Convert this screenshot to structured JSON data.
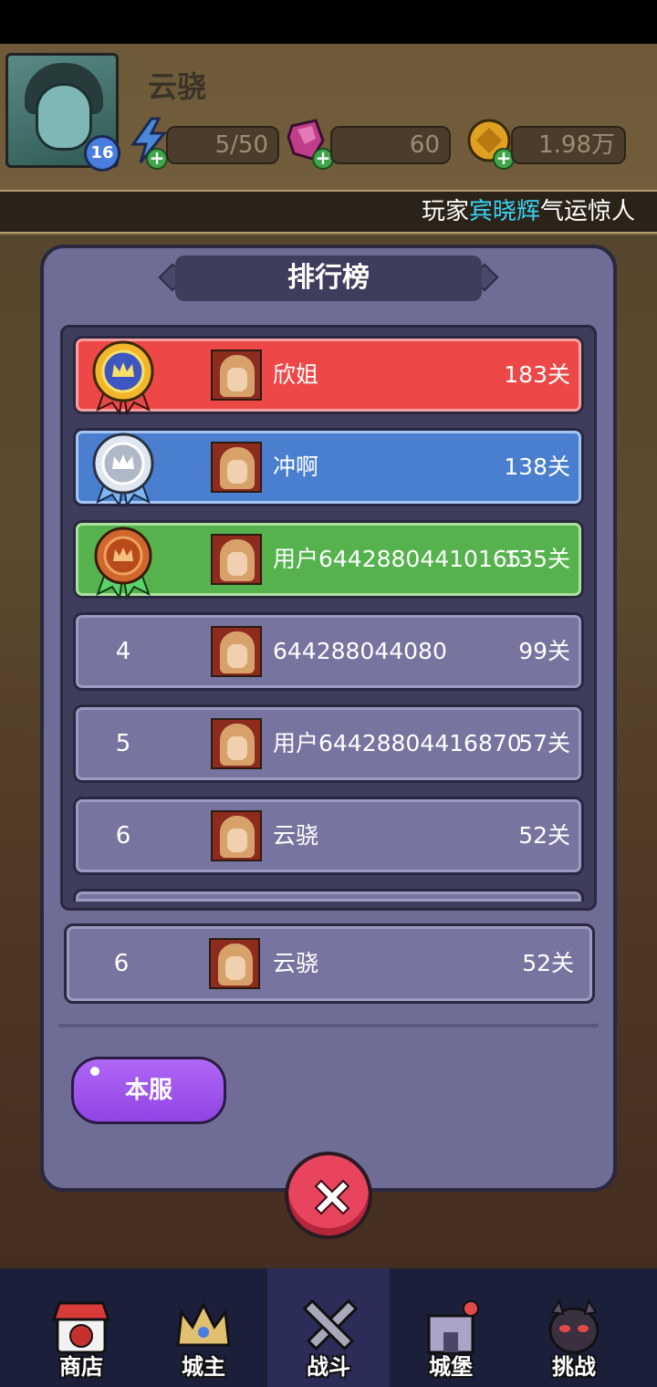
{
  "player": {
    "name": "云骁",
    "level": "16"
  },
  "resources": {
    "energy": "5/50",
    "gems": "60",
    "gold": "1.98万"
  },
  "marquee": {
    "prefix": "玩家",
    "highlight": "宾晓辉",
    "suffix": "气运惊人",
    "highlight_color": "#39d3f5"
  },
  "panel": {
    "title": "排行榜",
    "rows": [
      {
        "rank": "1",
        "medal": "gold-medal-icon",
        "name": "欣姐",
        "score": "183关",
        "color": "#ee4747"
      },
      {
        "rank": "2",
        "medal": "silver-medal-icon",
        "name": "冲啊",
        "score": "138关",
        "color": "#4a7fcf"
      },
      {
        "rank": "3",
        "medal": "bronze-medal-icon",
        "name": "用户64428804410165",
        "score": "135关",
        "color": "#55b24d"
      },
      {
        "rank": "4",
        "name": "644288044080",
        "score": "99关"
      },
      {
        "rank": "5",
        "name": "用户64428804416870",
        "score": "57关"
      },
      {
        "rank": "6",
        "name": "云骁",
        "score": "52关"
      }
    ],
    "my_rank": {
      "rank": "6",
      "name": "云骁",
      "score": "52关"
    },
    "tab_label": "本服",
    "close_icon": "close-x-icon"
  },
  "bottom_nav": [
    {
      "label": "商店",
      "icon": "shop-icon"
    },
    {
      "label": "城主",
      "icon": "crown-icon"
    },
    {
      "label": "战斗",
      "icon": "crossed-swords-icon",
      "active": true
    },
    {
      "label": "城堡",
      "icon": "castle-icon"
    },
    {
      "label": "挑战",
      "icon": "demon-mask-icon"
    }
  ]
}
